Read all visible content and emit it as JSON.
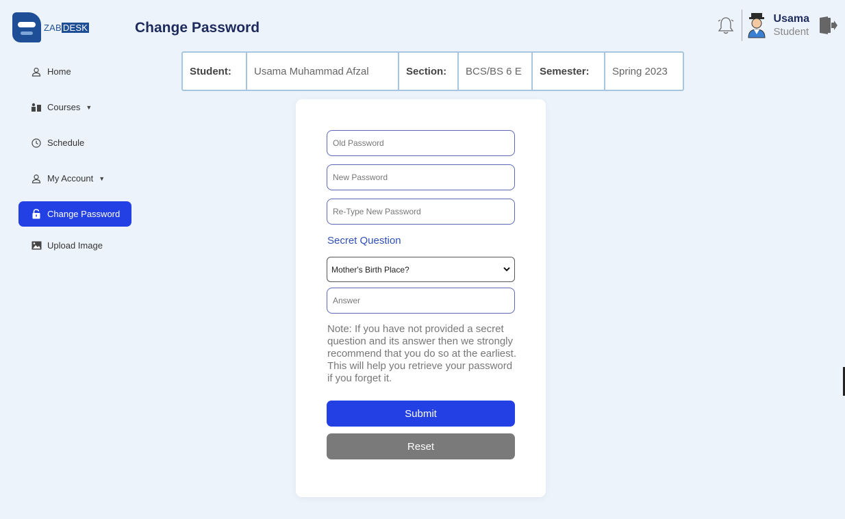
{
  "brand": {
    "logo_prefix": "ZAB",
    "logo_suffix": "DESK"
  },
  "header": {
    "page_title": "Change Password",
    "user_name": "Usama",
    "user_role": "Student",
    "icons": {
      "notifications": "bell-icon",
      "avatar": "student-avatar",
      "logout": "logout-icon"
    }
  },
  "sidebar": {
    "items": [
      {
        "label": "Home",
        "icon": "user-icon"
      },
      {
        "label": "Courses",
        "icon": "courses-icon",
        "has_dropdown": true
      },
      {
        "label": "Schedule",
        "icon": "clock-icon"
      },
      {
        "label": "My Account",
        "icon": "user-icon",
        "has_dropdown": true
      },
      {
        "label": "Change Password",
        "icon": "lock-icon",
        "active": true
      },
      {
        "label": "Upload Image",
        "icon": "image-icon"
      }
    ]
  },
  "info": {
    "student_label": "Student:",
    "student_value": "Usama Muhammad Afzal",
    "section_label": "Section:",
    "section_value": "BCS/BS 6 E",
    "semester_label": "Semester:",
    "semester_value": "Spring 2023"
  },
  "form": {
    "old_password_placeholder": "Old Password",
    "new_password_placeholder": "New Password",
    "retype_password_placeholder": "Re-Type New Password",
    "secret_question_label": "Secret Question",
    "secret_question_selected": "Mother's Birth Place?",
    "answer_placeholder": "Answer",
    "note": "Note: If you have not provided a secret question and its answer then we strongly recommend that you do so at the earliest. This will help you retrieve your password if you forget it.",
    "submit_label": "Submit",
    "reset_label": "Reset"
  },
  "colors": {
    "accent": "#2240e3",
    "title": "#1d2a5c",
    "background": "#edf3fb",
    "reset": "#7a7a7a"
  }
}
